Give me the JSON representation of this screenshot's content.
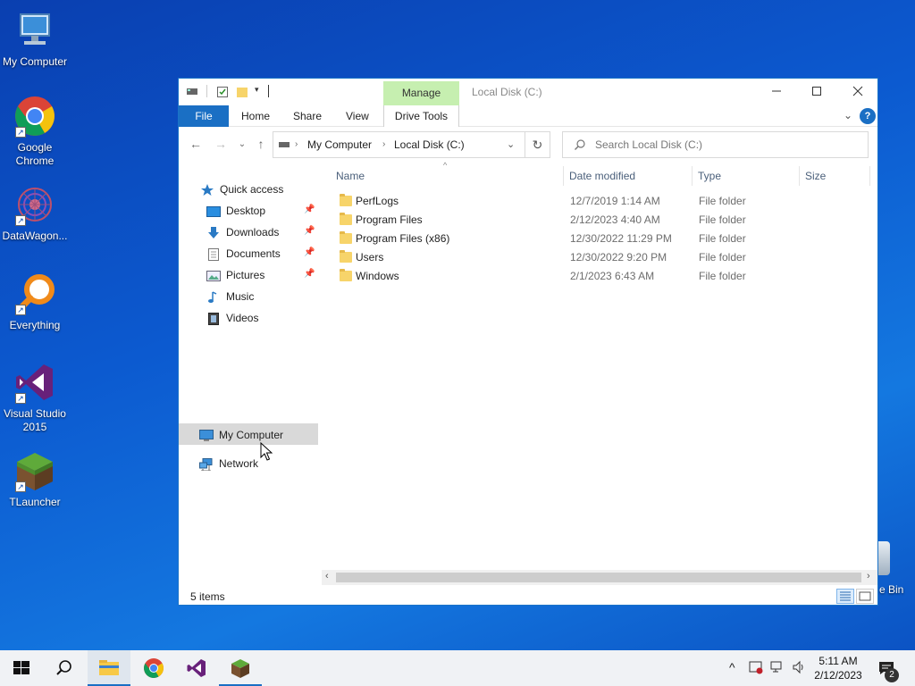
{
  "desktop": {
    "icons": [
      {
        "label": "My Computer"
      },
      {
        "label": "Google Chrome"
      },
      {
        "label": "DataWagon..."
      },
      {
        "label": "Everything"
      },
      {
        "label": "Visual Studio 2015"
      },
      {
        "label": "TLauncher"
      }
    ],
    "recycle_bin_partial": "e Bin"
  },
  "window": {
    "title": "Local Disk (C:)",
    "context_tab": "Manage",
    "ribbon_tabs": [
      "File",
      "Home",
      "Share",
      "View",
      "Drive Tools"
    ],
    "address": {
      "crumbs": [
        "My Computer",
        "Local Disk (C:)"
      ]
    },
    "search": {
      "placeholder": "Search Local Disk (C:)"
    },
    "nav": {
      "quick_access": "Quick access",
      "items": [
        "Desktop",
        "Downloads",
        "Documents",
        "Pictures",
        "Music",
        "Videos"
      ],
      "my_computer": "My Computer",
      "network": "Network"
    },
    "columns": [
      "Name",
      "Date modified",
      "Type",
      "Size"
    ],
    "files": [
      {
        "name": "PerfLogs",
        "date": "12/7/2019 1:14 AM",
        "type": "File folder"
      },
      {
        "name": "Program Files",
        "date": "2/12/2023 4:40 AM",
        "type": "File folder"
      },
      {
        "name": "Program Files (x86)",
        "date": "12/30/2022 11:29 PM",
        "type": "File folder"
      },
      {
        "name": "Users",
        "date": "12/30/2022 9:20 PM",
        "type": "File folder"
      },
      {
        "name": "Windows",
        "date": "2/1/2023 6:43 AM",
        "type": "File folder"
      }
    ],
    "status": "5 items"
  },
  "taskbar": {
    "time": "5:11 AM",
    "date": "2/12/2023",
    "notification_count": "2"
  },
  "colors": {
    "accent": "#1a6fc4",
    "manage_tab": "#c6efb0",
    "folder": "#f7d46a"
  }
}
